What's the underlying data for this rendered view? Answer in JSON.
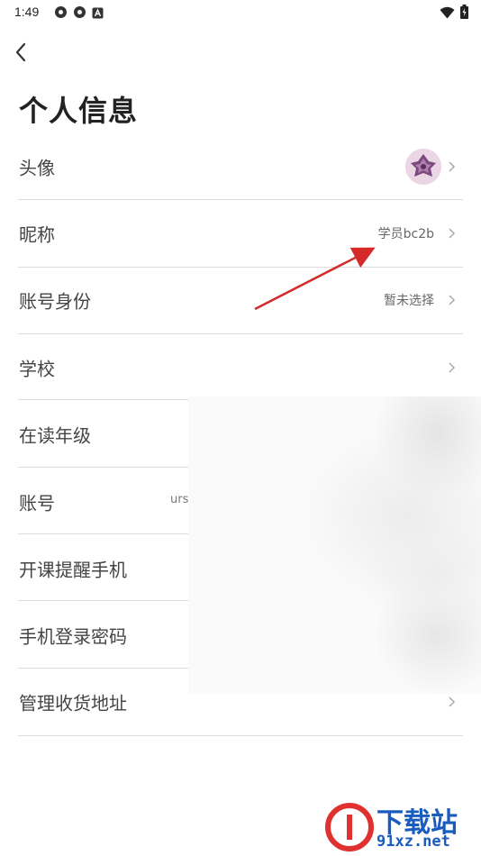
{
  "status_bar": {
    "time": "1:49",
    "left_icons": [
      "app-icon-1",
      "app-icon-2",
      "notification-icon"
    ],
    "right_icons": [
      "wifi-icon",
      "battery-icon"
    ]
  },
  "header": {
    "back_icon": "chevron-left-icon",
    "title": "个人信息"
  },
  "rows": [
    {
      "label": "头像",
      "value": "",
      "has_avatar": true,
      "has_chevron": true
    },
    {
      "label": "昵称",
      "value": "学员bc2b",
      "has_chevron": true
    },
    {
      "label": "账号身份",
      "value": "暂未选择",
      "has_chevron": true
    },
    {
      "label": "学校",
      "value": "",
      "has_chevron": true
    },
    {
      "label": "在读年级",
      "value": "",
      "has_chevron": false
    },
    {
      "label": "账号",
      "value": "urs",
      "has_chevron": false
    },
    {
      "label": "开课提醒手机",
      "value": "",
      "has_chevron": false
    },
    {
      "label": "手机登录密码",
      "value": "",
      "has_chevron": false
    },
    {
      "label": "管理收货地址",
      "value": "",
      "has_chevron": true
    }
  ],
  "watermark": {
    "brand": "下载站",
    "domain": "91xz.net"
  },
  "colors": {
    "title": "#222222",
    "label": "#444444",
    "value": "#666666",
    "divider": "#dcdcdc",
    "arrow": "#d42a2a",
    "watermark": "#1a5bbf"
  }
}
